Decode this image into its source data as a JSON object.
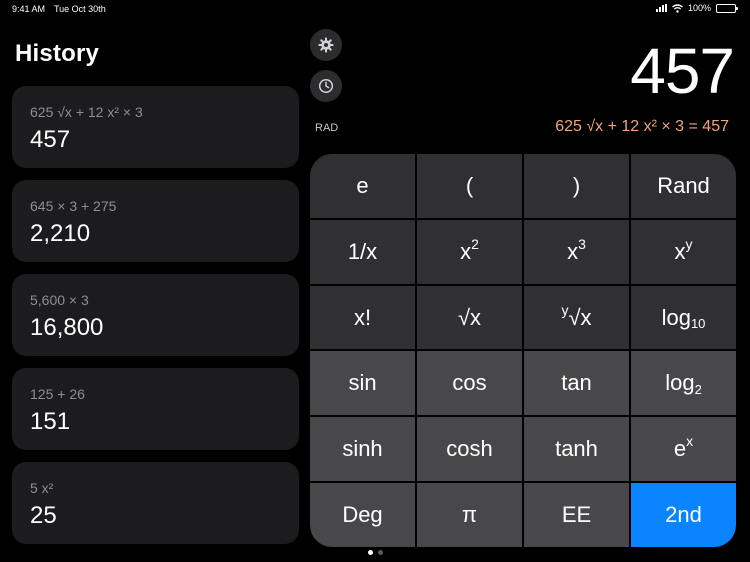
{
  "status_bar": {
    "time": "9:41 AM",
    "date": "Tue Oct 30th",
    "battery": "100%"
  },
  "history": {
    "title": "History",
    "items": [
      {
        "expression": "625 √x + 12 x² × 3",
        "result": "457"
      },
      {
        "expression": "645 × 3 + 275",
        "result": "2,210"
      },
      {
        "expression": "5,600 × 3",
        "result": "16,800"
      },
      {
        "expression": "125 + 26",
        "result": "151"
      },
      {
        "expression": "5 x²",
        "result": "25"
      }
    ]
  },
  "controls": {
    "settings_icon": "gear-icon",
    "history_icon": "clock-icon",
    "mode_label": "RAD"
  },
  "display": {
    "value": "457",
    "expression": "625 √x + 12 x² × 3 = 457",
    "expression_color": "#f0a57c"
  },
  "keypad": {
    "rows": [
      {
        "e": "e",
        "lparen": "(",
        "rparen": ")",
        "rand": "Rand"
      },
      {
        "recip": "1/x",
        "sq": "x",
        "sq_sup": "2",
        "cube": "x",
        "cube_sup": "3",
        "pow": "x",
        "pow_sup": "y"
      },
      {
        "fact": "x!",
        "sqrt": "√x",
        "yroot_sup": "y",
        "yroot": "√x",
        "log10": "log",
        "log10_sub": "10"
      },
      {
        "sin": "sin",
        "cos": "cos",
        "tan": "tan",
        "log2": "log",
        "log2_sub": "2"
      },
      {
        "sinh": "sinh",
        "cosh": "cosh",
        "tanh": "tanh",
        "exp": "e",
        "exp_sup": "x"
      },
      {
        "deg": "Deg",
        "pi": "π",
        "ee": "EE",
        "second": "2nd"
      }
    ]
  },
  "colors": {
    "accent": "#0a84ff",
    "card": "#1c1c1e",
    "key_dark": "#303033",
    "key_light": "#48484a"
  },
  "page_indicator": {
    "count": 2,
    "active": 1
  }
}
